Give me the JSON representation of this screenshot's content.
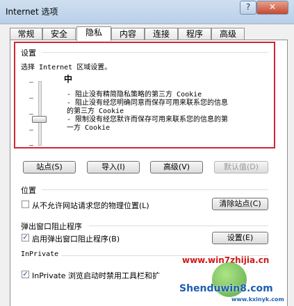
{
  "window": {
    "title": "Internet 选项",
    "help_glyph": "?",
    "close_glyph": "✕"
  },
  "tabs": [
    "常规",
    "安全",
    "隐私",
    "内容",
    "连接",
    "程序",
    "高级"
  ],
  "settings": {
    "group_label": "设置",
    "zone_text": "选择 Internet 区域设置。",
    "level": "中",
    "lines": [
      "- 阻止没有精简隐私策略的第三方 Cookie",
      "- 阻止没有经您明确同意而保存可用来联系您的信息",
      "的第三方 Cookie",
      "- 限制没有经您默许而保存可用来联系您的信息的第",
      "一方 Cookie"
    ]
  },
  "buttons": {
    "sites": "站点(S)",
    "import": "导入(I)",
    "advanced": "高级(V)",
    "default": "默认值(D)"
  },
  "location": {
    "group_label": "位置",
    "checkbox_label": "从不允许网站请求您的物理位置(L)",
    "clear_button": "清除站点(C)"
  },
  "popup": {
    "group_label": "弹出窗口阻止程序",
    "checkbox_label": "启用弹出窗口阻止程序(B)",
    "settings_button": "设置(E)"
  },
  "inprivate": {
    "group_label": "InPrivate",
    "checkbox_label": "InPrivate 浏览启动时禁用工具栏和扩"
  },
  "watermark": {
    "site1": "www.win7zhijia.cn",
    "brand": "Shenduwin8.com",
    "site2": "www.kxinyk.com"
  }
}
